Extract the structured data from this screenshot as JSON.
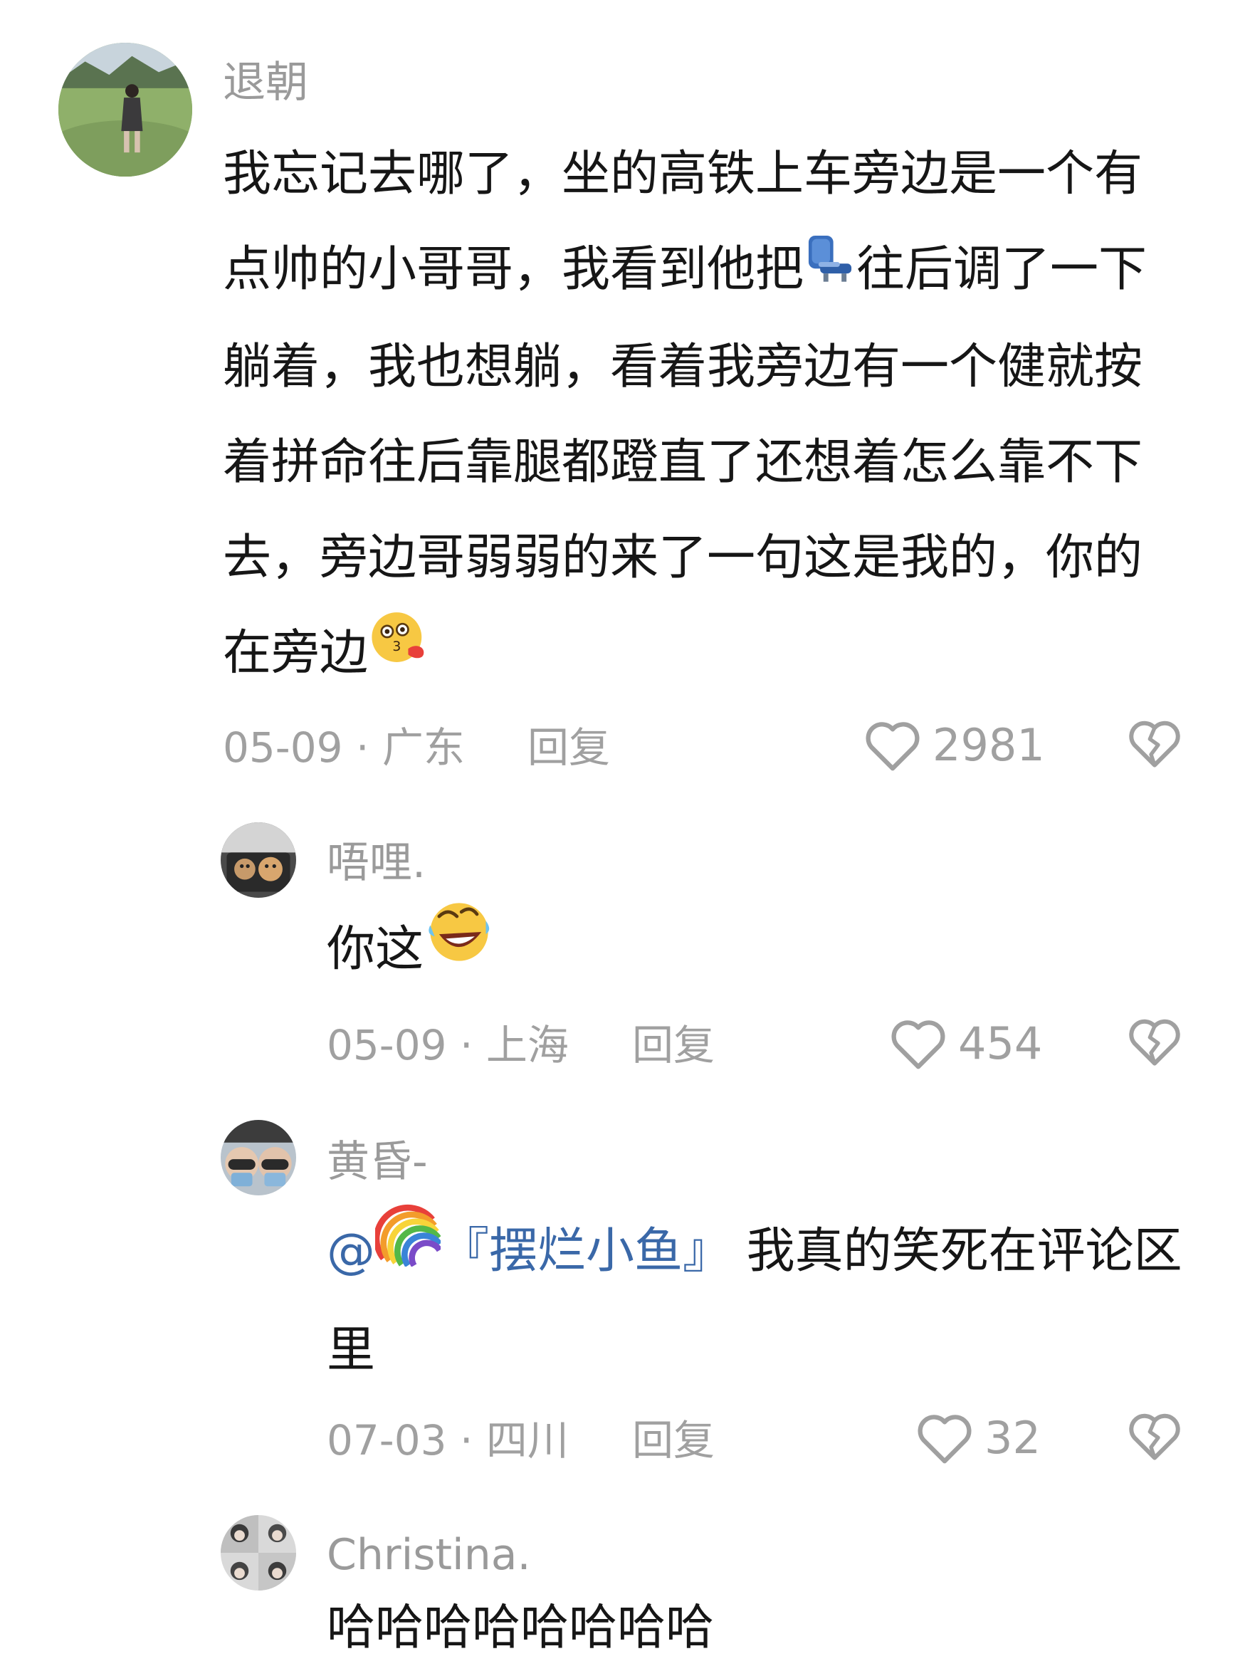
{
  "comments": [
    {
      "username": "退朝",
      "text_parts": [
        "我忘记去哪了，坐的高铁上车旁边是一个有点帅的小哥哥，我看到他把",
        "往后调了一下躺着，我也想躺，看着我旁边有一个健就按着拼命往后靠腿都蹬直了还想着怎么靠不下去，旁边哥弱弱的来了一句这是我的，你的在旁边"
      ],
      "emojis": [
        "seat-icon",
        "kiss-face-icon"
      ],
      "date": "05-09",
      "location": "广东",
      "reply_label": "回复",
      "likes": "2981"
    },
    {
      "username": "唔哩.",
      "text": "你这",
      "emoji": "rolling-laugh-icon",
      "date": "05-09",
      "location": "上海",
      "reply_label": "回复",
      "likes": "454"
    },
    {
      "username": "黄昏-",
      "mention": "@",
      "mention_name": "『摆烂小鱼』",
      "mention_emoji": "rainbow-icon",
      "text": " 我真的笑死在评论区里",
      "date": "07-03",
      "location": "四川",
      "reply_label": "回复",
      "likes": "32"
    },
    {
      "username": "Christina.",
      "text": "哈哈哈哈哈哈哈哈"
    }
  ],
  "separator": " · ",
  "colors": {
    "background": "#ffffff",
    "text": "#161616",
    "muted": "#a0a0a0",
    "mention": "#3a68a8"
  }
}
